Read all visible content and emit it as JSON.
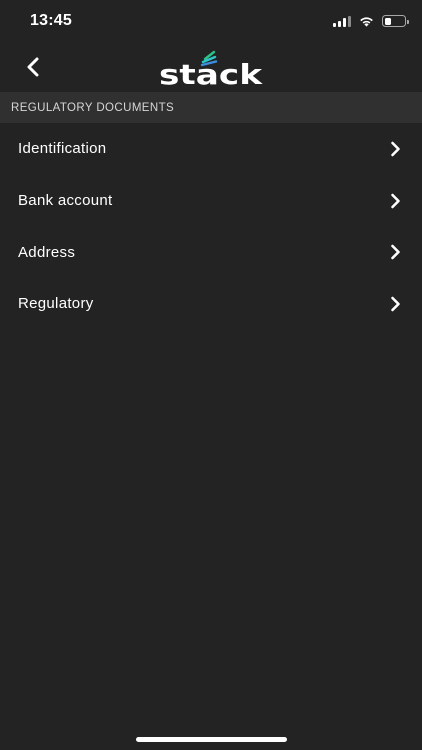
{
  "status_bar": {
    "time": "13:45",
    "icons": [
      "cellular-signal-icon",
      "wifi-icon",
      "battery-icon"
    ],
    "battery_level": 0.35
  },
  "nav": {
    "back_icon": "chevron-left-icon",
    "logo_text": "stack",
    "logo_colors": {
      "green": "#2bc48a",
      "blue": "#3b8fe0",
      "teal": "#2ec7c9"
    }
  },
  "section": {
    "header": "REGULATORY DOCUMENTS"
  },
  "items": [
    {
      "label": "Identification",
      "icon": "chevron-right-icon"
    },
    {
      "label": "Bank account",
      "icon": "chevron-right-icon"
    },
    {
      "label": "Address",
      "icon": "chevron-right-icon"
    },
    {
      "label": "Regulatory",
      "icon": "chevron-right-icon"
    }
  ],
  "colors": {
    "background": "#232323",
    "section_header_bg": "#303030",
    "text": "#ffffff"
  }
}
